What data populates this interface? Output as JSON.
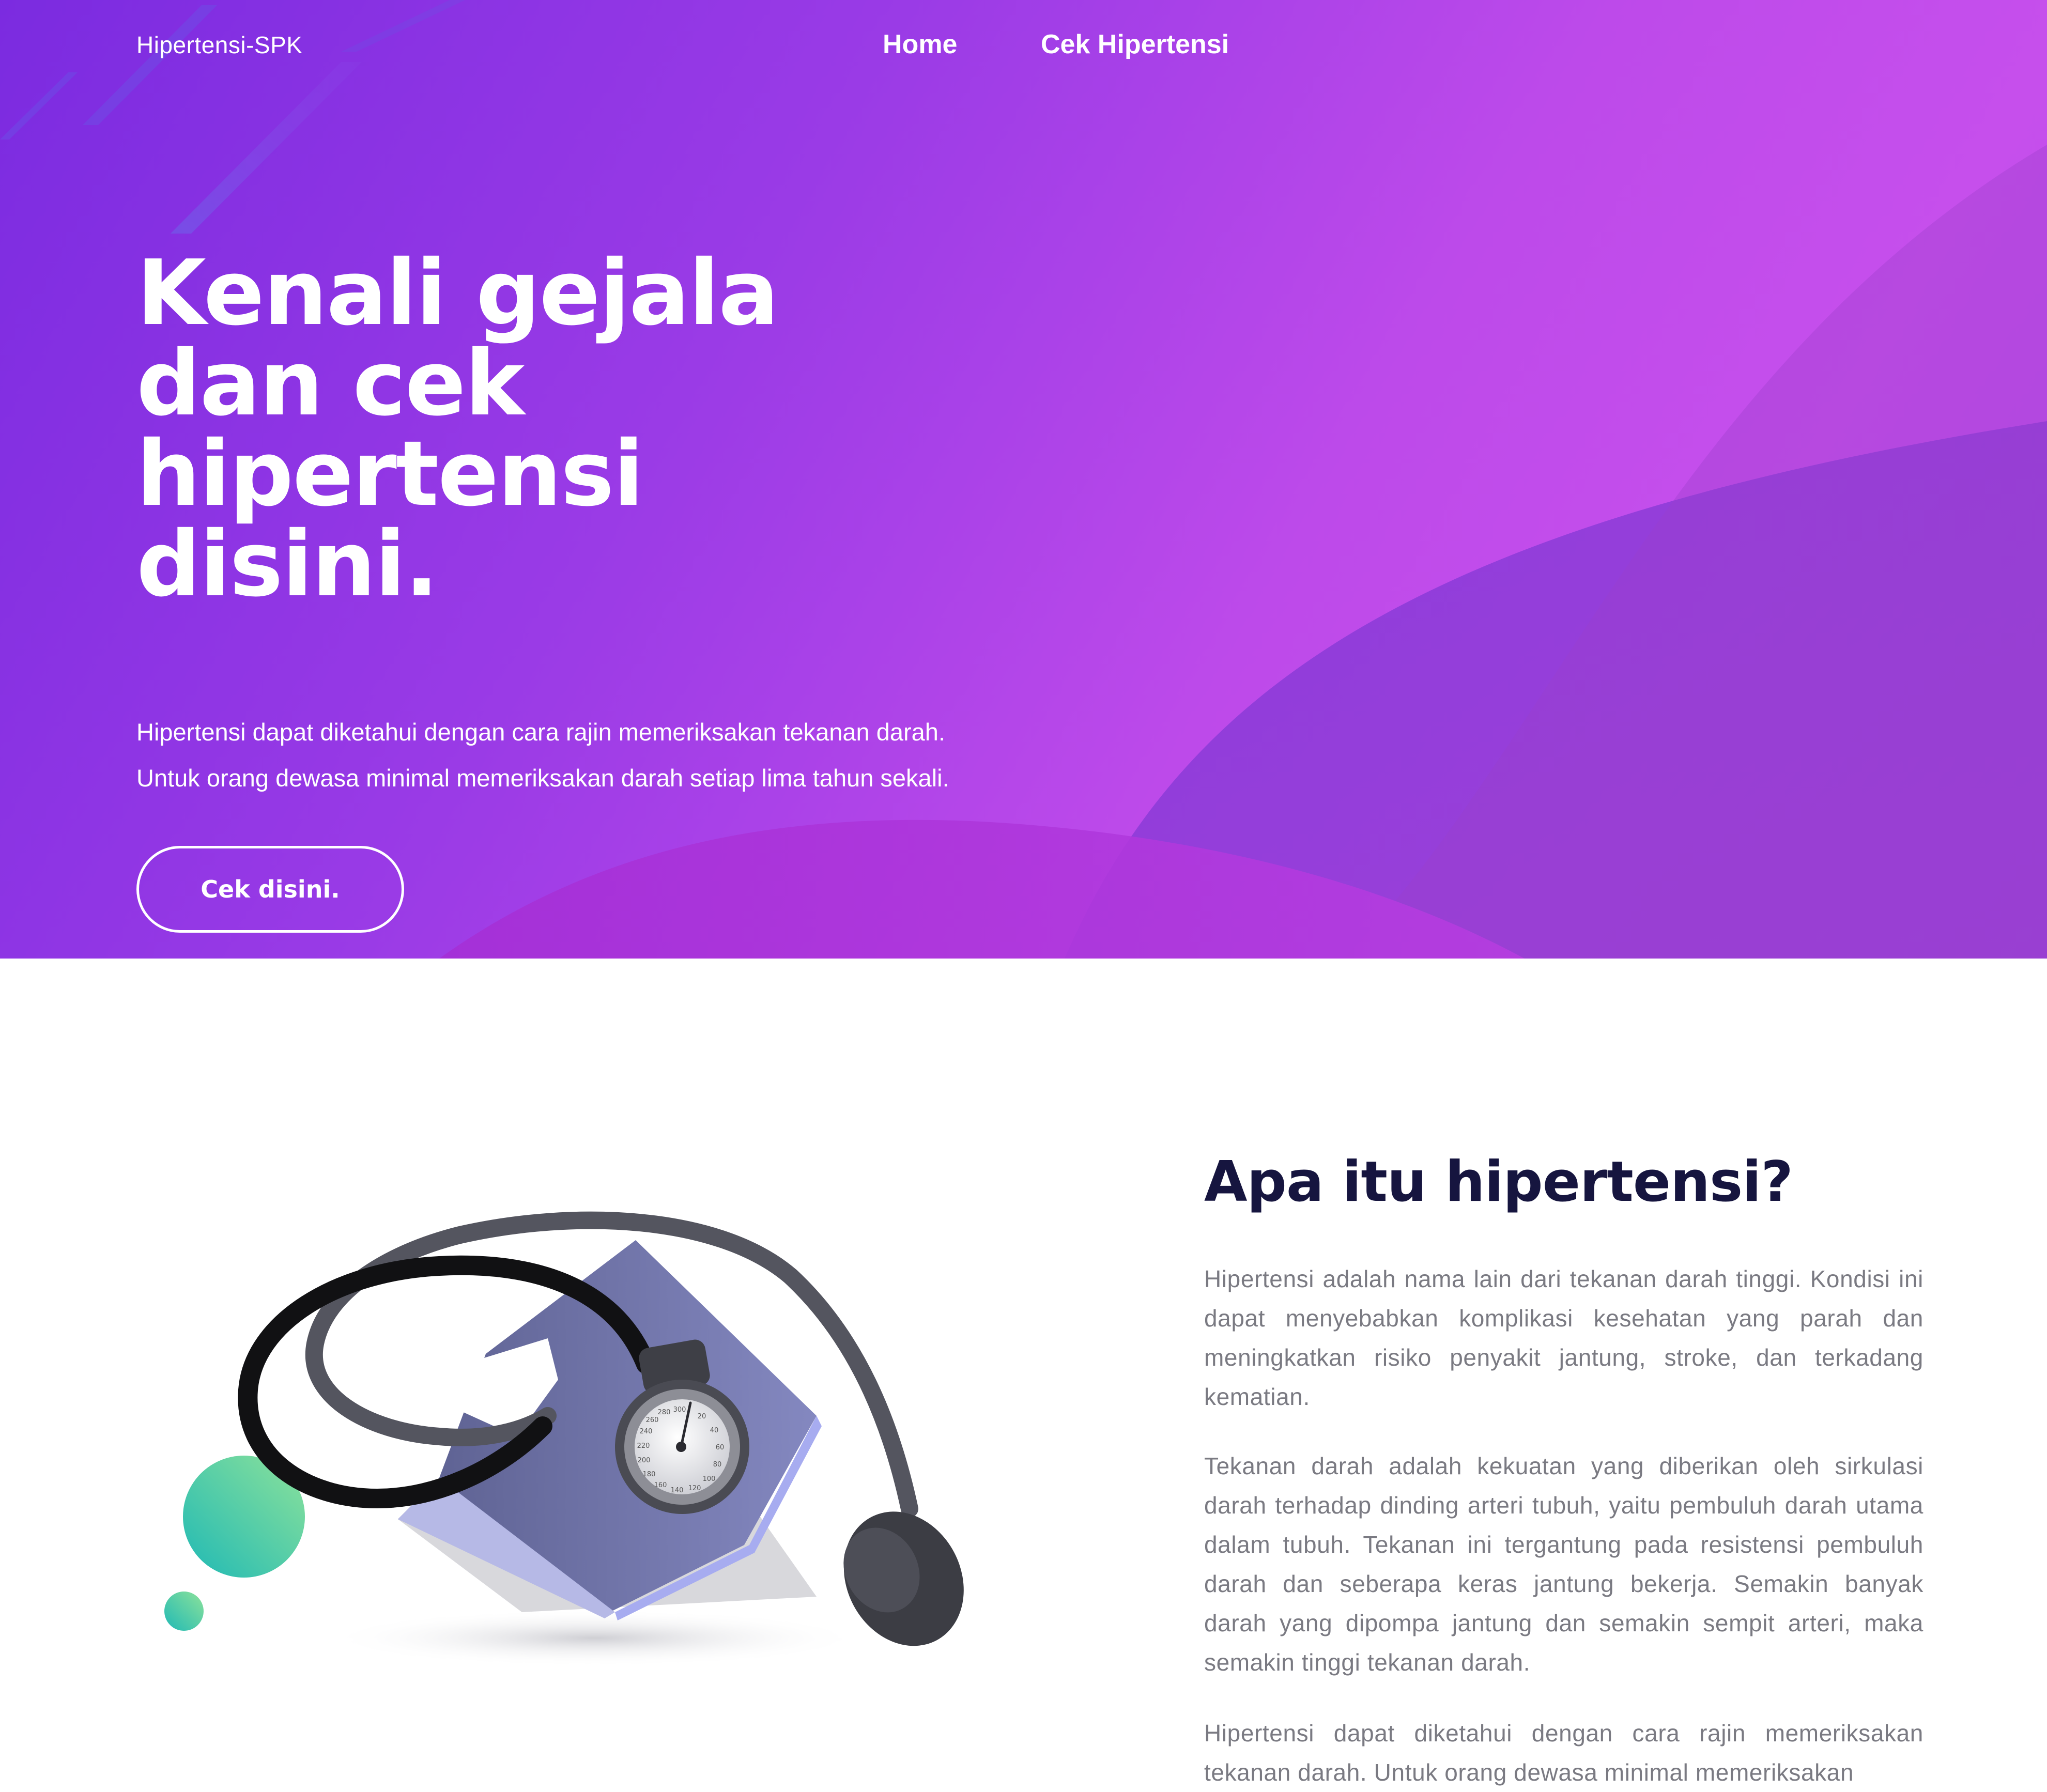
{
  "nav": {
    "brand": "Hipertensi-SPK",
    "links": [
      "Home",
      "Cek Hipertensi"
    ]
  },
  "hero": {
    "title": "Kenali gejala dan cek hipertensi disini.",
    "description_lines": [
      "Hipertensi dapat diketahui dengan cara rajin memeriksakan tekanan darah.",
      "Untuk orang dewasa minimal memeriksakan darah setiap lima tahun sekali."
    ],
    "button_label": "Cek disini."
  },
  "about": {
    "title": "Apa itu hipertensi?",
    "paragraphs": [
      "Hipertensi adalah nama lain dari tekanan darah tinggi. Kondisi ini dapat menyebabkan komplikasi kesehatan yang parah dan meningkatkan risiko penyakit jantung, stroke, dan terkadang kematian.",
      "Tekanan darah adalah kekuatan yang diberikan oleh sirkulasi darah terhadap dinding arteri tubuh, yaitu pembuluh darah utama dalam tubuh. Tekanan ini tergantung pada resistensi pembuluh darah dan seberapa keras jantung bekerja. Semakin banyak darah yang dipompa jantung dan semakin sempit arteri, maka semakin tinggi tekanan darah.",
      "Hipertensi dapat diketahui dengan cara rajin memeriksakan tekanan darah. Untuk orang dewasa minimal memeriksakan"
    ]
  },
  "gauge": {
    "dial_numbers": [
      "300",
      "20",
      "40",
      "60",
      "80",
      "100",
      "120",
      "140",
      "160",
      "180",
      "200",
      "220",
      "240",
      "260",
      "280"
    ]
  },
  "colors": {
    "hero_purple": "#8a34e3",
    "hero_pink": "#c64fec",
    "title_navy": "#16153f",
    "body_gray": "#7a7a82",
    "cuff_blue": "#7b7fb3",
    "accent_teal": "#2ec4b6"
  }
}
